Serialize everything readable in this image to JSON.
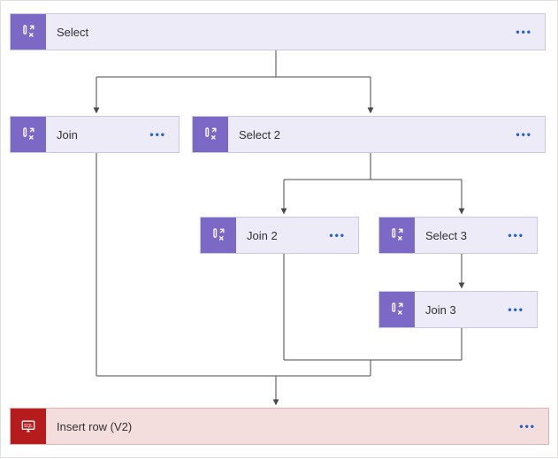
{
  "colors": {
    "data_bg": "#ecebf7",
    "data_icon": "#7c69c6",
    "sql_bg": "#f4dddd",
    "sql_icon": "#b61c1c",
    "connector": "#4a4a4a"
  },
  "nodes": {
    "select": {
      "label": "Select",
      "type": "data"
    },
    "join": {
      "label": "Join",
      "type": "data"
    },
    "select2": {
      "label": "Select 2",
      "type": "data"
    },
    "join2": {
      "label": "Join 2",
      "type": "data"
    },
    "select3": {
      "label": "Select 3",
      "type": "data"
    },
    "join3": {
      "label": "Join 3",
      "type": "data"
    },
    "insert": {
      "label": "Insert row (V2)",
      "type": "sql"
    }
  },
  "icons": {
    "data_name": "data-operations-icon",
    "sql_name": "sql-icon"
  }
}
